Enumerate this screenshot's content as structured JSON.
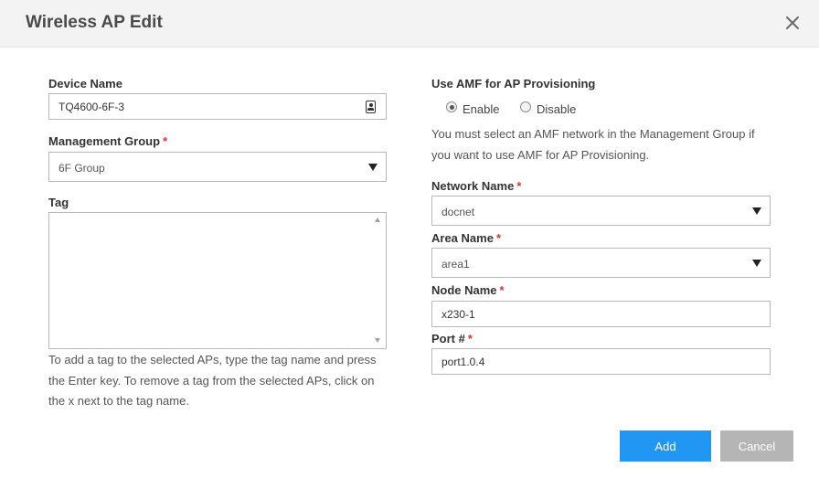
{
  "dialog": {
    "title": "Wireless AP Edit"
  },
  "left": {
    "device_name": {
      "label": "Device Name",
      "value": "TQ4600-6F-3"
    },
    "management_group": {
      "label": "Management Group",
      "required": "*",
      "selected": "6F Group"
    },
    "tag": {
      "label": "Tag",
      "value": ""
    },
    "tag_help": [
      "To add a tag to the selected APs, type the tag name and press",
      "the Enter key. To remove a tag from the selected APs, click on",
      "the x next to the tag name."
    ]
  },
  "right": {
    "amf": {
      "label": "Use AMF for AP Provisioning",
      "options": [
        {
          "label": "Enable",
          "checked": true
        },
        {
          "label": "Disable",
          "checked": false
        }
      ],
      "help": [
        "You must select an AMF network in the Management Group if",
        "you want to use AMF for AP Provisioning."
      ]
    },
    "network_name": {
      "label": "Network Name",
      "required": "*",
      "selected": "docnet"
    },
    "area_name": {
      "label": "Area Name",
      "required": "*",
      "selected": "area1"
    },
    "node_name": {
      "label": "Node Name",
      "required": "*",
      "value": "x230-1"
    },
    "port": {
      "label": "Port #",
      "required": "*",
      "value": "port1.0.4"
    }
  },
  "footer": {
    "add_label": "Add",
    "cancel_label": "Cancel"
  },
  "colors": {
    "primary": "#2196f3",
    "cancel": "#b5b5b5",
    "required": "#d9333f"
  },
  "icons": [
    "close-icon",
    "contact-card-icon",
    "chevron-down-icon",
    "scroll-up-icon",
    "scroll-down-icon"
  ]
}
